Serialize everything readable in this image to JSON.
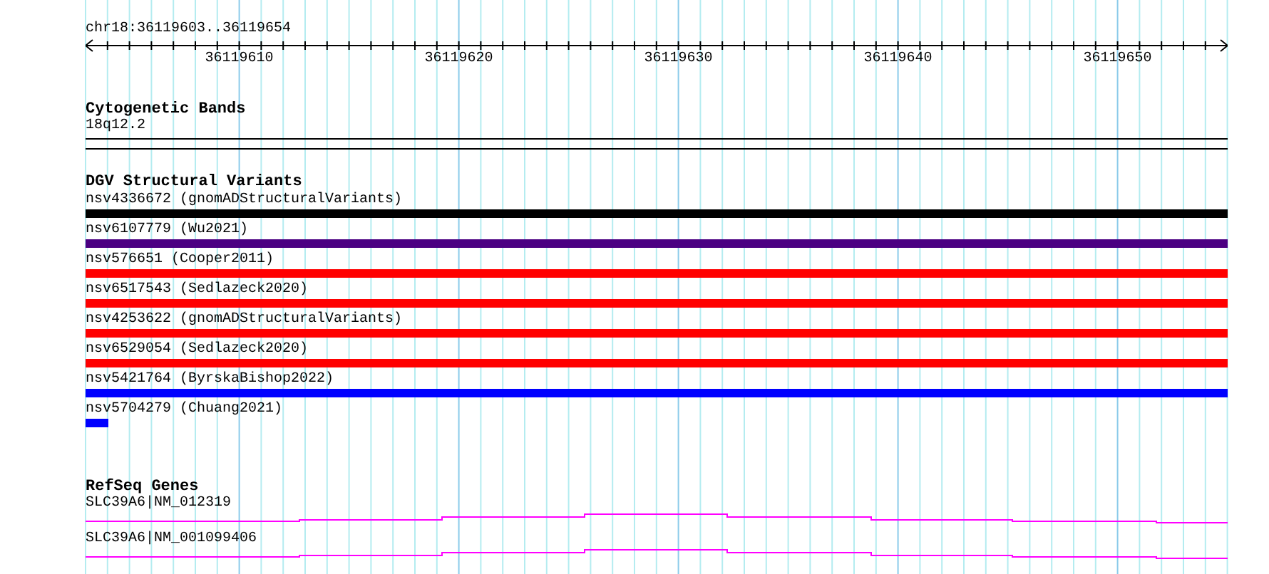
{
  "ruler": {
    "range": "chr18:36119603..36119654",
    "labels": [
      "36119610",
      "36119620",
      "36119630",
      "36119640",
      "36119650"
    ]
  },
  "cytogenetic_bands": {
    "title": "Cytogenetic Bands",
    "band": "18q12.2"
  },
  "dgv": {
    "title": "DGV Structural Variants",
    "items": [
      {
        "label": "nsv4336672 (gnomADStructuralVariants)",
        "color": "#000000",
        "kind": "full"
      },
      {
        "label": "nsv6107779 (Wu2021)",
        "color": "#4b0082",
        "kind": "full"
      },
      {
        "label": "nsv576651 (Cooper2011)",
        "color": "#ff0000",
        "kind": "full"
      },
      {
        "label": "nsv6517543 (Sedlazeck2020)",
        "color": "#ff0000",
        "kind": "full"
      },
      {
        "label": "nsv4253622 (gnomADStructuralVariants)",
        "color": "#ff0000",
        "kind": "full"
      },
      {
        "label": "nsv6529054 (Sedlazeck2020)",
        "color": "#ff0000",
        "kind": "full"
      },
      {
        "label": "nsv5421764 (ByrskaBishop2022)",
        "color": "#0000ff",
        "kind": "full"
      },
      {
        "label": "nsv5704279 (Chuang2021)",
        "color": "#0000ff",
        "kind": "start"
      }
    ]
  },
  "refseq": {
    "title": "RefSeq Genes",
    "genes": [
      {
        "label": "SLC39A6|NM_012319"
      },
      {
        "label": "SLC39A6|NM_001099406"
      }
    ]
  }
}
